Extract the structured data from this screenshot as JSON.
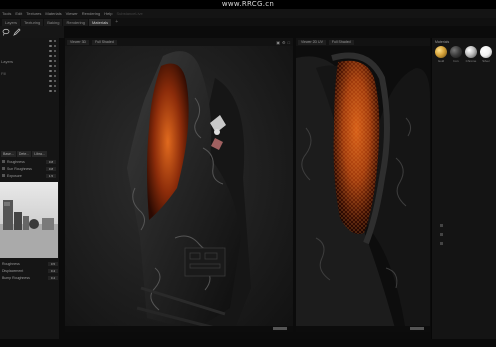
{
  "watermark": "www.RRCG.cn",
  "menubar": {
    "items": [
      "Tools",
      "Edit",
      "Textures",
      "Materials",
      "Viewer",
      "Rendering",
      "Help",
      "SubstanceLive"
    ]
  },
  "tabs": {
    "items": [
      "Layers",
      "Texturing",
      "Baking",
      "Rendering",
      "Materials"
    ],
    "active_index": 4,
    "add_label": "+"
  },
  "toolbar": {
    "icons": [
      "lasso-icon",
      "pen-icon"
    ]
  },
  "left_panel": {
    "layers_header": "Layers",
    "layer_row_label": "Fill",
    "prop_tabs": [
      "Base...",
      "Dete...",
      "Libra..."
    ],
    "props": [
      {
        "label": "Roughness",
        "value": "0.8"
      },
      {
        "label": "Sun Roughness",
        "value": "0.8"
      },
      {
        "label": "Exposure",
        "value": "1.5"
      }
    ],
    "env_props": [
      {
        "label": "Roughness",
        "value": "0.5"
      },
      {
        "label": "Displacement",
        "value": "0.4"
      },
      {
        "label": "Bump Roughness",
        "value": "0.4"
      }
    ]
  },
  "viewport_left": {
    "camera": "Viewer 3D",
    "mode": "Full Shaded"
  },
  "viewport_right": {
    "camera": "Viewer 2D UV",
    "mode": "Full Shaded"
  },
  "shelf": {
    "title": "Materials",
    "materials": [
      {
        "label": "Gold",
        "color": "#d6a33a"
      },
      {
        "label": "Iron",
        "color": "#3a3a3a"
      },
      {
        "label": "Chrome",
        "color": "#bcbcbc"
      },
      {
        "label": "Silver",
        "color": "#f2f2f2"
      }
    ]
  }
}
